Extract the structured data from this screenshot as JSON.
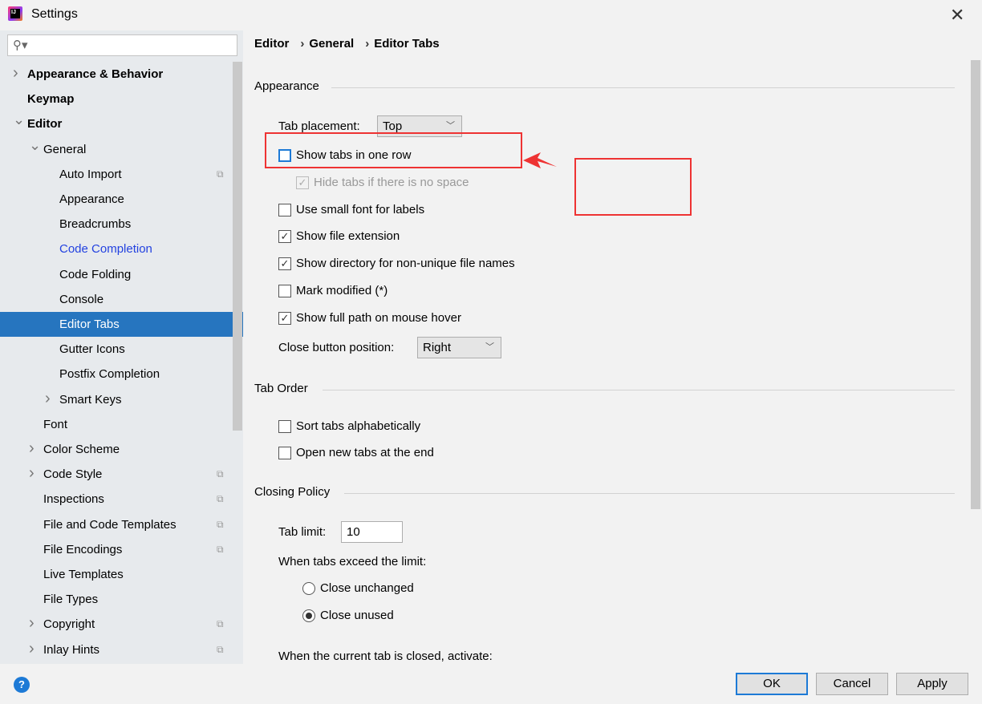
{
  "window": {
    "title": "Settings",
    "close_icon": "close-icon"
  },
  "search": {
    "placeholder": "",
    "icon": "search-icon"
  },
  "sidebar": {
    "items": [
      {
        "label": "Appearance & Behavior",
        "level": 0,
        "arrow": "right",
        "bold": true
      },
      {
        "label": "Keymap",
        "level": 0,
        "bold": true
      },
      {
        "label": "Editor",
        "level": 0,
        "arrow": "down",
        "bold": true
      },
      {
        "label": "General",
        "level": 1,
        "arrow": "down"
      },
      {
        "label": "Auto Import",
        "level": 2,
        "copy": true
      },
      {
        "label": "Appearance",
        "level": 2
      },
      {
        "label": "Breadcrumbs",
        "level": 2
      },
      {
        "label": "Code Completion",
        "level": 2,
        "link": true
      },
      {
        "label": "Code Folding",
        "level": 2
      },
      {
        "label": "Console",
        "level": 2
      },
      {
        "label": "Editor Tabs",
        "level": 2,
        "selected": true
      },
      {
        "label": "Gutter Icons",
        "level": 2
      },
      {
        "label": "Postfix Completion",
        "level": 2
      },
      {
        "label": "Smart Keys",
        "level": 2,
        "arrow": "right"
      },
      {
        "label": "Font",
        "level": 1
      },
      {
        "label": "Color Scheme",
        "level": 1,
        "arrow": "right"
      },
      {
        "label": "Code Style",
        "level": 1,
        "arrow": "right",
        "copy": true
      },
      {
        "label": "Inspections",
        "level": 1,
        "copy": true
      },
      {
        "label": "File and Code Templates",
        "level": 1,
        "copy": true
      },
      {
        "label": "File Encodings",
        "level": 1,
        "copy": true
      },
      {
        "label": "Live Templates",
        "level": 1
      },
      {
        "label": "File Types",
        "level": 1
      },
      {
        "label": "Copyright",
        "level": 1,
        "arrow": "right",
        "copy": true
      },
      {
        "label": "Inlay Hints",
        "level": 1,
        "arrow": "right",
        "copy": true
      }
    ]
  },
  "breadcrumb": [
    "Editor",
    "General",
    "Editor Tabs"
  ],
  "appearance": {
    "title": "Appearance",
    "tab_placement_label": "Tab placement:",
    "tab_placement_value": "Top",
    "show_one_row": {
      "label": "Show tabs in one row",
      "checked": false
    },
    "hide_tabs": {
      "label": "Hide tabs if there is no space",
      "checked": true,
      "disabled": true
    },
    "small_font": {
      "label": "Use small font for labels",
      "checked": false
    },
    "file_ext": {
      "label": "Show file extension",
      "checked": true
    },
    "show_dir": {
      "label": "Show directory for non-unique file names",
      "checked": true
    },
    "mark_modified": {
      "label": "Mark modified (*)",
      "checked": false
    },
    "full_path": {
      "label": "Show full path on mouse hover",
      "checked": true
    },
    "close_btn_label": "Close button position:",
    "close_btn_value": "Right"
  },
  "tab_order": {
    "title": "Tab Order",
    "sort": {
      "label": "Sort tabs alphabetically",
      "checked": false
    },
    "open_end": {
      "label": "Open new tabs at the end",
      "checked": false
    }
  },
  "closing": {
    "title": "Closing Policy",
    "tab_limit_label": "Tab limit:",
    "tab_limit_value": "10",
    "exceed_label": "When tabs exceed the limit:",
    "close_unchanged": "Close unchanged",
    "close_unused": "Close unused",
    "selected": "Close unused",
    "activate_label": "When the current tab is closed, activate:"
  },
  "footer": {
    "ok": "OK",
    "cancel": "Cancel",
    "apply": "Apply",
    "help": "?"
  },
  "annotation_color": "#ee3333"
}
